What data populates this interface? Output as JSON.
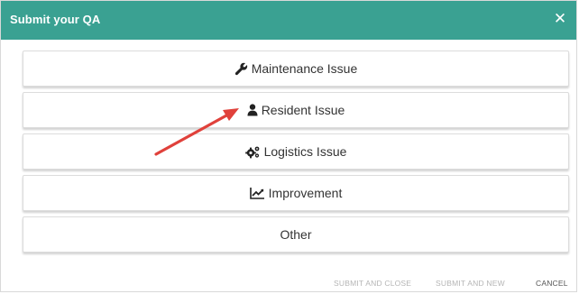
{
  "dialog": {
    "title": "Submit your QA",
    "close_label": "✕",
    "accent_color": "#3aa192"
  },
  "options": [
    {
      "label": "Maintenance Issue",
      "icon": "wrench-icon"
    },
    {
      "label": "Resident Issue",
      "icon": "user-icon"
    },
    {
      "label": "Logistics Issue",
      "icon": "gears-icon"
    },
    {
      "label": "Improvement",
      "icon": "line-chart-icon"
    },
    {
      "label": "Other",
      "icon": ""
    }
  ],
  "footer": {
    "submit_close_label": "SUBMIT AND CLOSE",
    "submit_new_label": "SUBMIT AND NEW",
    "cancel_label": "CANCEL"
  },
  "annotation": {
    "arrow_color": "#e0413b"
  }
}
